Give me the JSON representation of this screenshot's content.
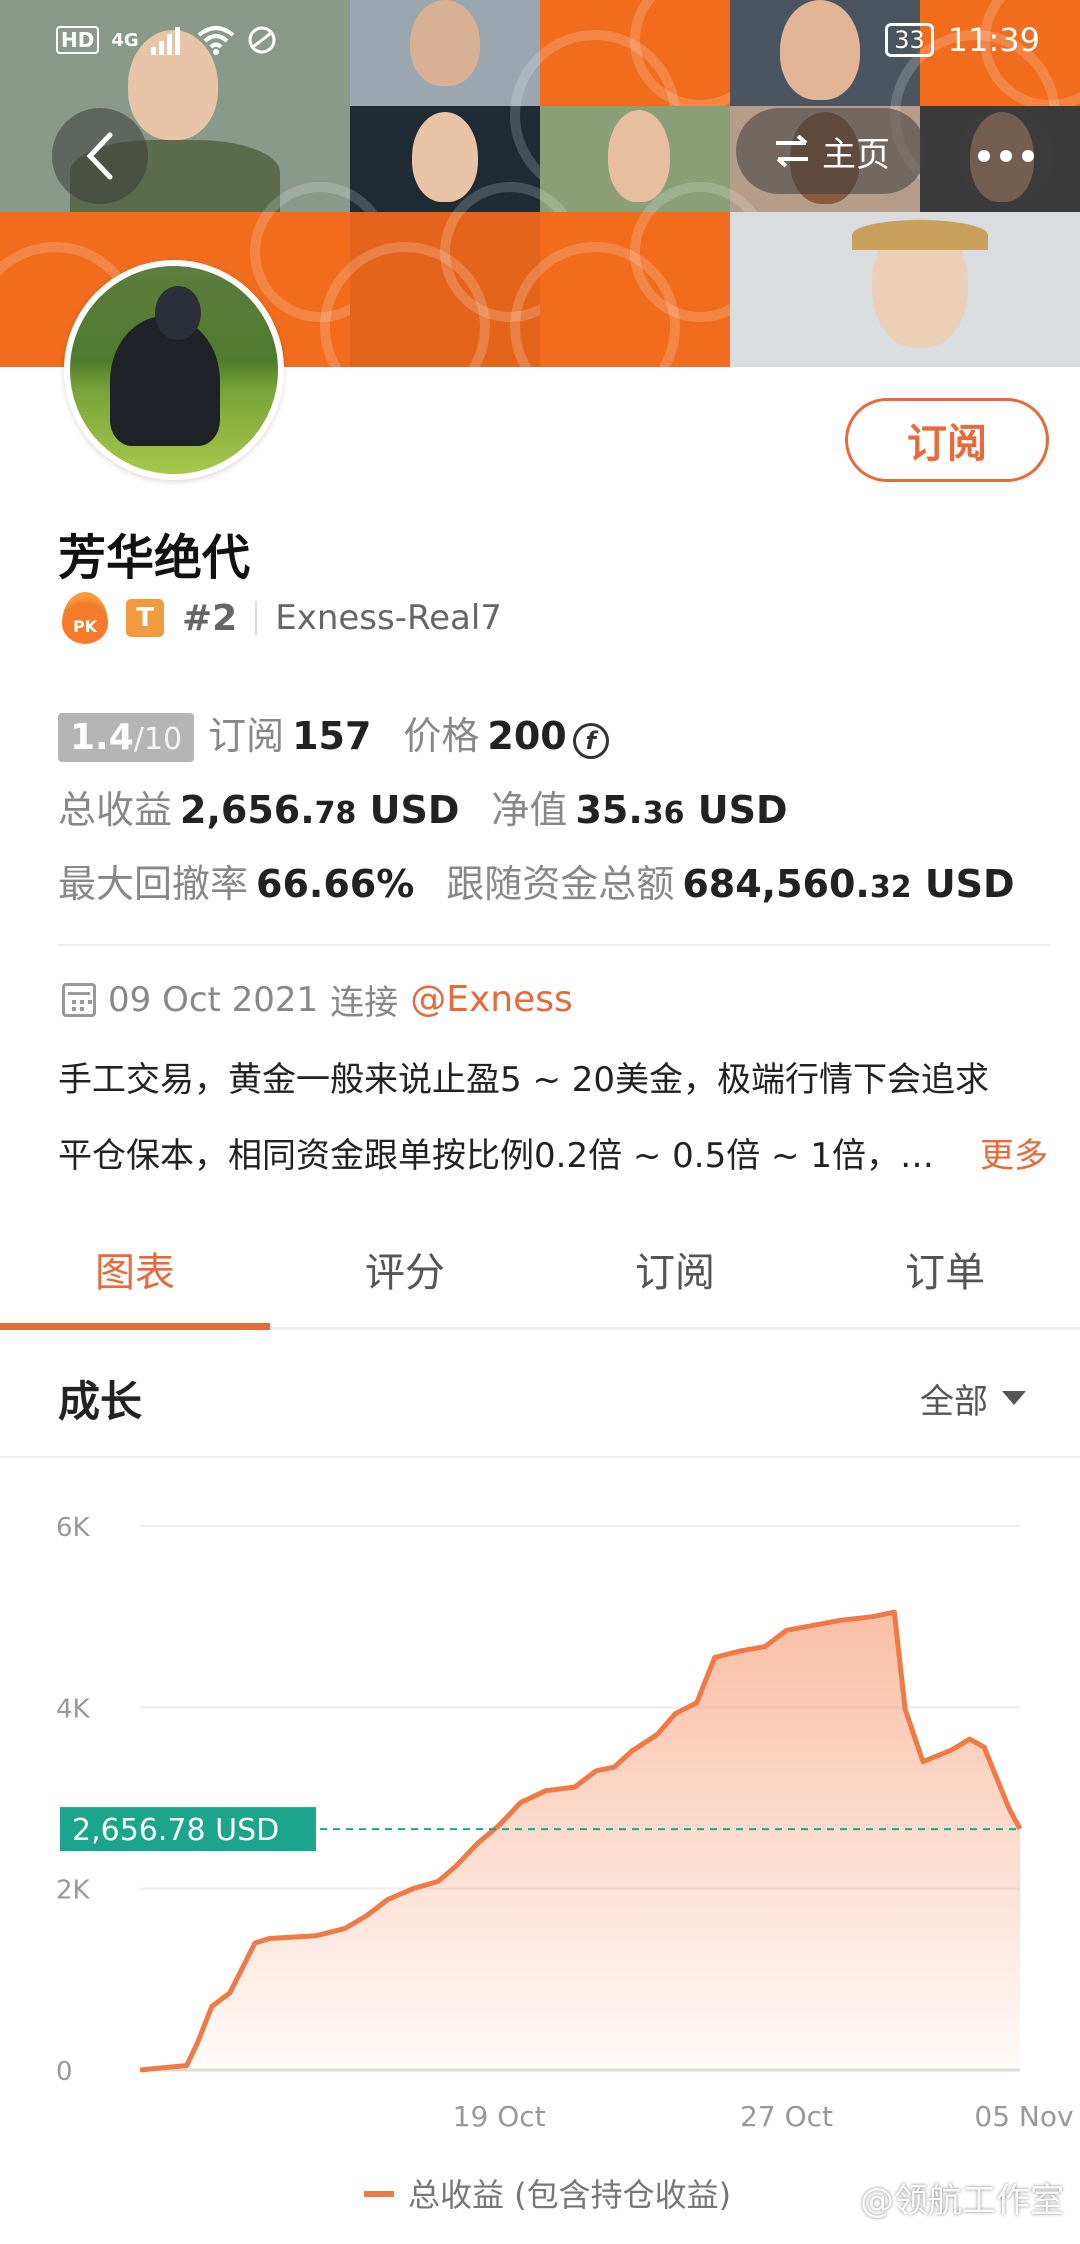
{
  "status_bar": {
    "network": "HD",
    "signal": "4G",
    "battery": "33",
    "time": "11:39"
  },
  "nav": {
    "home_label": "主页",
    "back_icon": "chevron-left-icon",
    "more_icon": "more-dots-icon"
  },
  "profile": {
    "name": "芳华绝代",
    "rank": "#2",
    "t_badge": "T",
    "pk_badge": "PK",
    "account": "Exness-Real7",
    "subscribe_label": "订阅"
  },
  "stats": {
    "score": "1.4",
    "score_max": "/10",
    "subscribe_label": "订阅",
    "subscribe_count": "157",
    "price_label": "价格",
    "price_value": "200",
    "total_profit_label": "总收益",
    "total_profit_int": "2,656.",
    "total_profit_dec": "78",
    "currency": "USD",
    "net_value_label": "净值",
    "net_value_int": "35.",
    "net_value_dec": "36",
    "max_drawdown_label": "最大回撤率",
    "max_drawdown": "66.66%",
    "follow_funds_label": "跟随资金总额",
    "follow_funds_int": "684,560.",
    "follow_funds_dec": "32"
  },
  "connection": {
    "date": "09 Oct 2021",
    "connect_label": "连接",
    "broker": "@Exness"
  },
  "description": {
    "line1": "手工交易，黄金一般来说止盈5 ~ 20美金，极端行情下会追求",
    "line2": "平仓保本，相同资金跟单按比例0.2倍 ~ 0.5倍 ~ 1倍，…",
    "more_label": "更多"
  },
  "tabs": [
    {
      "label": "图表",
      "active": true
    },
    {
      "label": "评分",
      "active": false
    },
    {
      "label": "订阅",
      "active": false
    },
    {
      "label": "订单",
      "active": false
    }
  ],
  "section": {
    "title": "成长",
    "filter_label": "全部"
  },
  "chart_data": {
    "type": "area",
    "y_ticks": [
      "6K",
      "4K",
      "2K",
      "0"
    ],
    "y_tick_values": [
      6000,
      4000,
      2000,
      0
    ],
    "ylim": [
      0,
      6000
    ],
    "x_ticks": [
      "19 Oct",
      "27 Oct",
      "05 Nov"
    ],
    "x_tick_days": [
      10,
      18,
      27
    ],
    "current_value_label": "2,656.78 USD",
    "current_value": 2656.78,
    "legend": "总收益 (包含持仓收益)",
    "line_color": "#f07a45",
    "reference_line_color": "#1aa58c",
    "series": [
      {
        "name": "总收益 (包含持仓收益)",
        "points": [
          [
            0,
            0
          ],
          [
            1.3,
            50
          ],
          [
            1.6,
            300
          ],
          [
            2.0,
            700
          ],
          [
            2.5,
            850
          ],
          [
            3.2,
            1400
          ],
          [
            3.6,
            1450
          ],
          [
            4.9,
            1480
          ],
          [
            5.7,
            1560
          ],
          [
            6.3,
            1700
          ],
          [
            6.9,
            1880
          ],
          [
            7.6,
            2000
          ],
          [
            8.3,
            2080
          ],
          [
            8.8,
            2250
          ],
          [
            9.4,
            2500
          ],
          [
            10.0,
            2700
          ],
          [
            10.6,
            2950
          ],
          [
            11.3,
            3080
          ],
          [
            12.1,
            3120
          ],
          [
            12.7,
            3300
          ],
          [
            13.2,
            3340
          ],
          [
            13.7,
            3520
          ],
          [
            14.4,
            3700
          ],
          [
            14.9,
            3930
          ],
          [
            15.5,
            4050
          ],
          [
            16.0,
            4550
          ],
          [
            16.7,
            4620
          ],
          [
            17.4,
            4670
          ],
          [
            18.0,
            4850
          ],
          [
            18.7,
            4900
          ],
          [
            19.5,
            4960
          ],
          [
            20.4,
            5000
          ],
          [
            21.0,
            5050
          ],
          [
            21.3,
            3980
          ],
          [
            21.8,
            3400
          ],
          [
            22.6,
            3530
          ],
          [
            23.1,
            3650
          ],
          [
            23.5,
            3560
          ],
          [
            24.2,
            2880
          ],
          [
            24.5,
            2660
          ]
        ]
      }
    ]
  },
  "watermark": "@领航工作室"
}
